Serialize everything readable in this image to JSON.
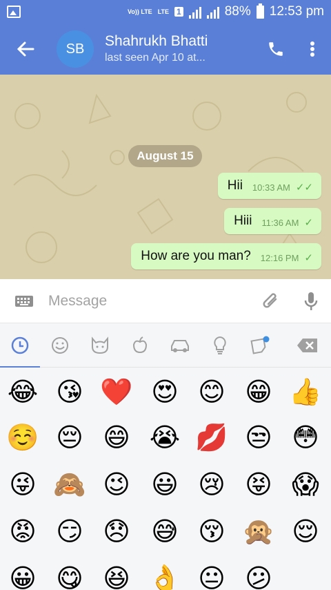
{
  "status_bar": {
    "network": "Vo)) LTE",
    "lte": "LTE",
    "sim": "1",
    "battery": "88%",
    "time": "12:53 pm"
  },
  "header": {
    "avatar_initials": "SB",
    "name": "Shahrukh Bhatti",
    "status": "last seen Apr 10 at..."
  },
  "chat": {
    "date_chip": "August 15",
    "messages": [
      {
        "text": "Hii",
        "time": "10:33 AM",
        "status": "read"
      },
      {
        "text": "Hiii",
        "time": "11:36 AM",
        "status": "sent"
      },
      {
        "text": "How are you man?",
        "time": "12:16 PM",
        "status": "sent"
      }
    ]
  },
  "input": {
    "placeholder": "Message"
  },
  "emoji_keyboard": {
    "tabs": [
      "recent-icon",
      "smileys-icon",
      "animals-icon",
      "food-icon",
      "travel-icon",
      "objects-icon",
      "stickers-icon"
    ],
    "active_tab": "recent-icon",
    "rows": [
      [
        "😂",
        "😘",
        "❤️",
        "😍",
        "😊",
        "😁",
        "👍"
      ],
      [
        "☺️",
        "😔",
        "😄",
        "😭",
        "💋",
        "😒",
        "😳"
      ],
      [
        "😜",
        "🙈",
        "😉",
        "😃",
        "😢",
        "😝",
        "😱"
      ],
      [
        "😡",
        "😏",
        "😞",
        "😅",
        "😚",
        "🙊",
        "😌"
      ],
      [
        "😀",
        "😋",
        "😆",
        "👌",
        "😐",
        "😕"
      ]
    ]
  },
  "colors": {
    "primary": "#5a7fd6",
    "bubble": "#d7fac3",
    "chat_bg": "#d9cfab"
  }
}
